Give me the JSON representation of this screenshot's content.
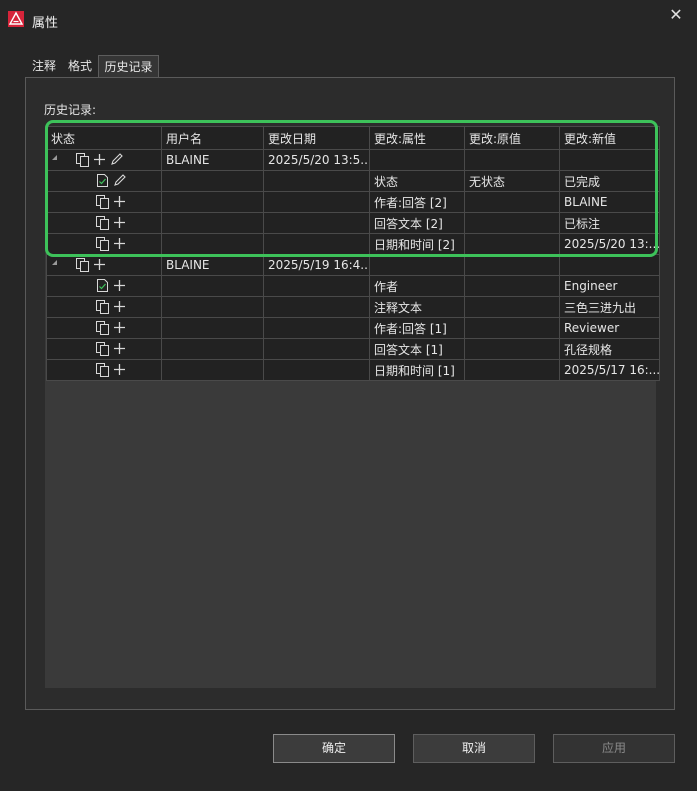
{
  "window": {
    "title": "属性",
    "close_glyph": "✕",
    "logo_icon": "app-logo-icon"
  },
  "tabs": [
    {
      "label": "注释"
    },
    {
      "label": "格式"
    },
    {
      "label": "历史记录",
      "selected": true
    }
  ],
  "history": {
    "label": "历史记录:",
    "columns": [
      "状态",
      "用户名",
      "更改日期",
      "更改:属性",
      "更改:原值",
      "更改:新值"
    ],
    "rows": [
      {
        "level": 0,
        "icons": [
          "copy-icon",
          "plus-icon",
          "pencil-icon"
        ],
        "user": "BLAINE",
        "date": "2025/5/20 13:5...",
        "property": "",
        "old": "",
        "new": ""
      },
      {
        "level": 1,
        "icons": [
          "check-document-icon",
          "pencil-icon"
        ],
        "user": "",
        "date": "",
        "property": "状态",
        "old": "无状态",
        "new": "已完成"
      },
      {
        "level": 1,
        "icons": [
          "copy-icon",
          "plus-icon"
        ],
        "user": "",
        "date": "",
        "property": "作者:回答 [2]",
        "old": "",
        "new": "BLAINE"
      },
      {
        "level": 1,
        "icons": [
          "copy-icon",
          "plus-icon"
        ],
        "user": "",
        "date": "",
        "property": "回答文本 [2]",
        "old": "",
        "new": "已标注"
      },
      {
        "level": 1,
        "icons": [
          "copy-icon",
          "plus-icon"
        ],
        "user": "",
        "date": "",
        "property": "日期和时间 [2]",
        "old": "",
        "new": "2025/5/20 13:..."
      },
      {
        "level": 0,
        "icons": [
          "copy-icon",
          "plus-icon"
        ],
        "user": "BLAINE",
        "date": "2025/5/19 16:4...",
        "property": "",
        "old": "",
        "new": ""
      },
      {
        "level": 1,
        "icons": [
          "check-document-icon",
          "plus-icon"
        ],
        "user": "",
        "date": "",
        "property": "作者",
        "old": "",
        "new": "Engineer"
      },
      {
        "level": 1,
        "icons": [
          "copy-icon",
          "plus-icon"
        ],
        "user": "",
        "date": "",
        "property": "注释文本",
        "old": "",
        "new": "三色三进九出"
      },
      {
        "level": 1,
        "icons": [
          "copy-icon",
          "plus-icon"
        ],
        "user": "",
        "date": "",
        "property": "作者:回答 [1]",
        "old": "",
        "new": "Reviewer"
      },
      {
        "level": 1,
        "icons": [
          "copy-icon",
          "plus-icon"
        ],
        "user": "",
        "date": "",
        "property": "回答文本 [1]",
        "old": "",
        "new": "孔径规格"
      },
      {
        "level": 1,
        "icons": [
          "copy-icon",
          "plus-icon"
        ],
        "user": "",
        "date": "",
        "property": "日期和时间 [1]",
        "old": "",
        "new": "2025/5/17 16:..."
      }
    ]
  },
  "buttons": {
    "ok": "确定",
    "cancel": "取消",
    "apply": "应用"
  },
  "colors": {
    "highlight": "#3dc25a",
    "logo": "#d6243a"
  }
}
